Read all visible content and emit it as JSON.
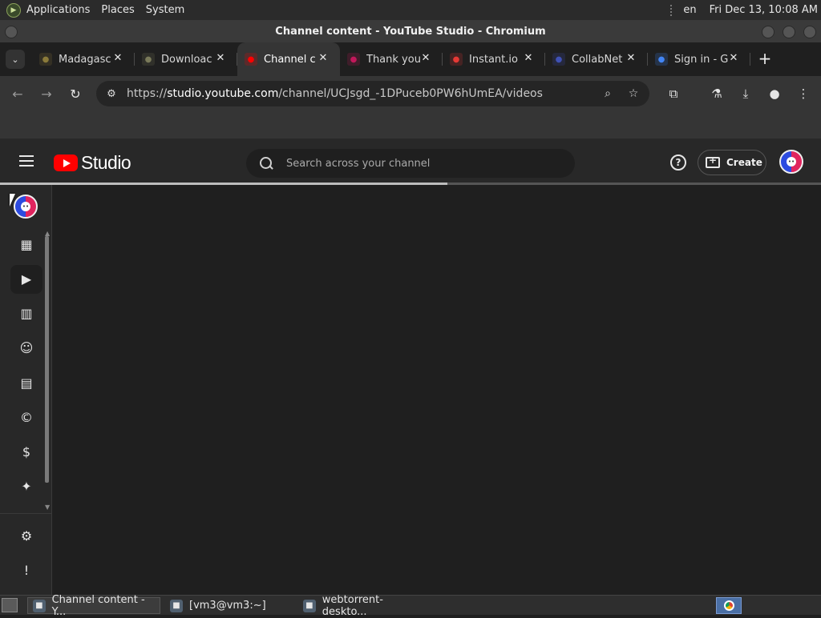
{
  "desktop": {
    "top_panel": {
      "menus": [
        "Applications",
        "Places",
        "System"
      ],
      "language": "en",
      "clock": "Fri Dec 13, 10:08 AM"
    },
    "taskbar": {
      "tasks": [
        {
          "label": "Channel content - Y...",
          "icon": "chromium-icon",
          "active": true
        },
        {
          "label": "[vm3@vm3:~]",
          "icon": "terminal-icon",
          "active": false
        },
        {
          "label": "webtorrent-deskto...",
          "icon": "app-icon",
          "active": false
        }
      ]
    }
  },
  "window": {
    "title": "Channel content - YouTube Studio - Chromium"
  },
  "browser": {
    "tabs": [
      {
        "label": "Madagasc",
        "favicon": "madagascar-favicon",
        "fav_color": "#8a7a3a",
        "active": false
      },
      {
        "label": "Downloac",
        "favicon": "download-favicon",
        "fav_color": "#7a7a5a",
        "active": false
      },
      {
        "label": "Channel c",
        "favicon": "youtube-favicon",
        "fav_color": "#ff0000",
        "active": true
      },
      {
        "label": "Thank you",
        "favicon": "heart-shield-favicon",
        "fav_color": "#c2185b",
        "active": false
      },
      {
        "label": "Instant.io",
        "favicon": "heart-favicon",
        "fav_color": "#e53935",
        "active": false
      },
      {
        "label": "CollabNet",
        "favicon": "collabnet-favicon",
        "fav_color": "#3f51b5",
        "active": false
      },
      {
        "label": "Sign in - G",
        "favicon": "google-favicon",
        "fav_color": "#4285f4",
        "active": false
      }
    ],
    "address": {
      "url_prefix": "https://",
      "url_host": "studio.youtube.com",
      "url_path": "/channel/UCJsgd_-1DPuceb0PW6hUmEA/videos"
    }
  },
  "studio": {
    "logo_text": "Studio",
    "search_placeholder": "Search across your channel",
    "create_label": "Create",
    "help_label": "?",
    "load_progress": 0.545,
    "side_nav": [
      {
        "name": "dashboard",
        "icon": "dashboard-icon",
        "active": false
      },
      {
        "name": "content",
        "icon": "content-icon",
        "active": true
      },
      {
        "name": "analytics",
        "icon": "analytics-icon",
        "active": false
      },
      {
        "name": "community",
        "icon": "community-icon",
        "active": false
      },
      {
        "name": "subtitles",
        "icon": "subtitles-icon",
        "active": false
      },
      {
        "name": "copyright",
        "icon": "copyright-icon",
        "active": false
      },
      {
        "name": "earn",
        "icon": "earn-icon",
        "active": false
      },
      {
        "name": "customization",
        "icon": "customization-icon",
        "active": false
      },
      {
        "name": "settings",
        "icon": "settings-icon",
        "active": false
      },
      {
        "name": "send-feedback",
        "icon": "feedback-icon",
        "active": false
      }
    ]
  },
  "colors": {
    "yt_red": "#ff0000",
    "background": "#1f1f1f",
    "header": "#282828"
  }
}
